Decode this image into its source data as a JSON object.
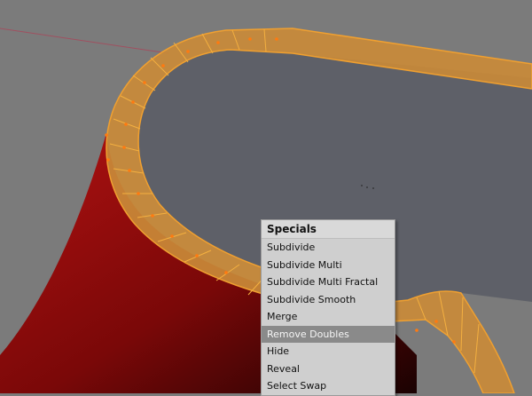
{
  "viewport": {
    "name": "3d-viewport",
    "colors": {
      "background": "#7b7b7b",
      "face_top": "#5e6068",
      "selected_edge": "#f0a030",
      "selected_face": "#c98a38",
      "vertex": "#ff7a10",
      "cylinder_side": "#8a0c0c"
    }
  },
  "specials_menu": {
    "title": "Specials",
    "active_index": 5,
    "items": [
      {
        "label": "Subdivide"
      },
      {
        "label": "Subdivide Multi"
      },
      {
        "label": "Subdivide Multi Fractal"
      },
      {
        "label": "Subdivide Smooth"
      },
      {
        "label": "Merge"
      },
      {
        "label": "Remove Doubles"
      },
      {
        "label": "Hide"
      },
      {
        "label": "Reveal"
      },
      {
        "label": "Select Swap"
      }
    ]
  }
}
